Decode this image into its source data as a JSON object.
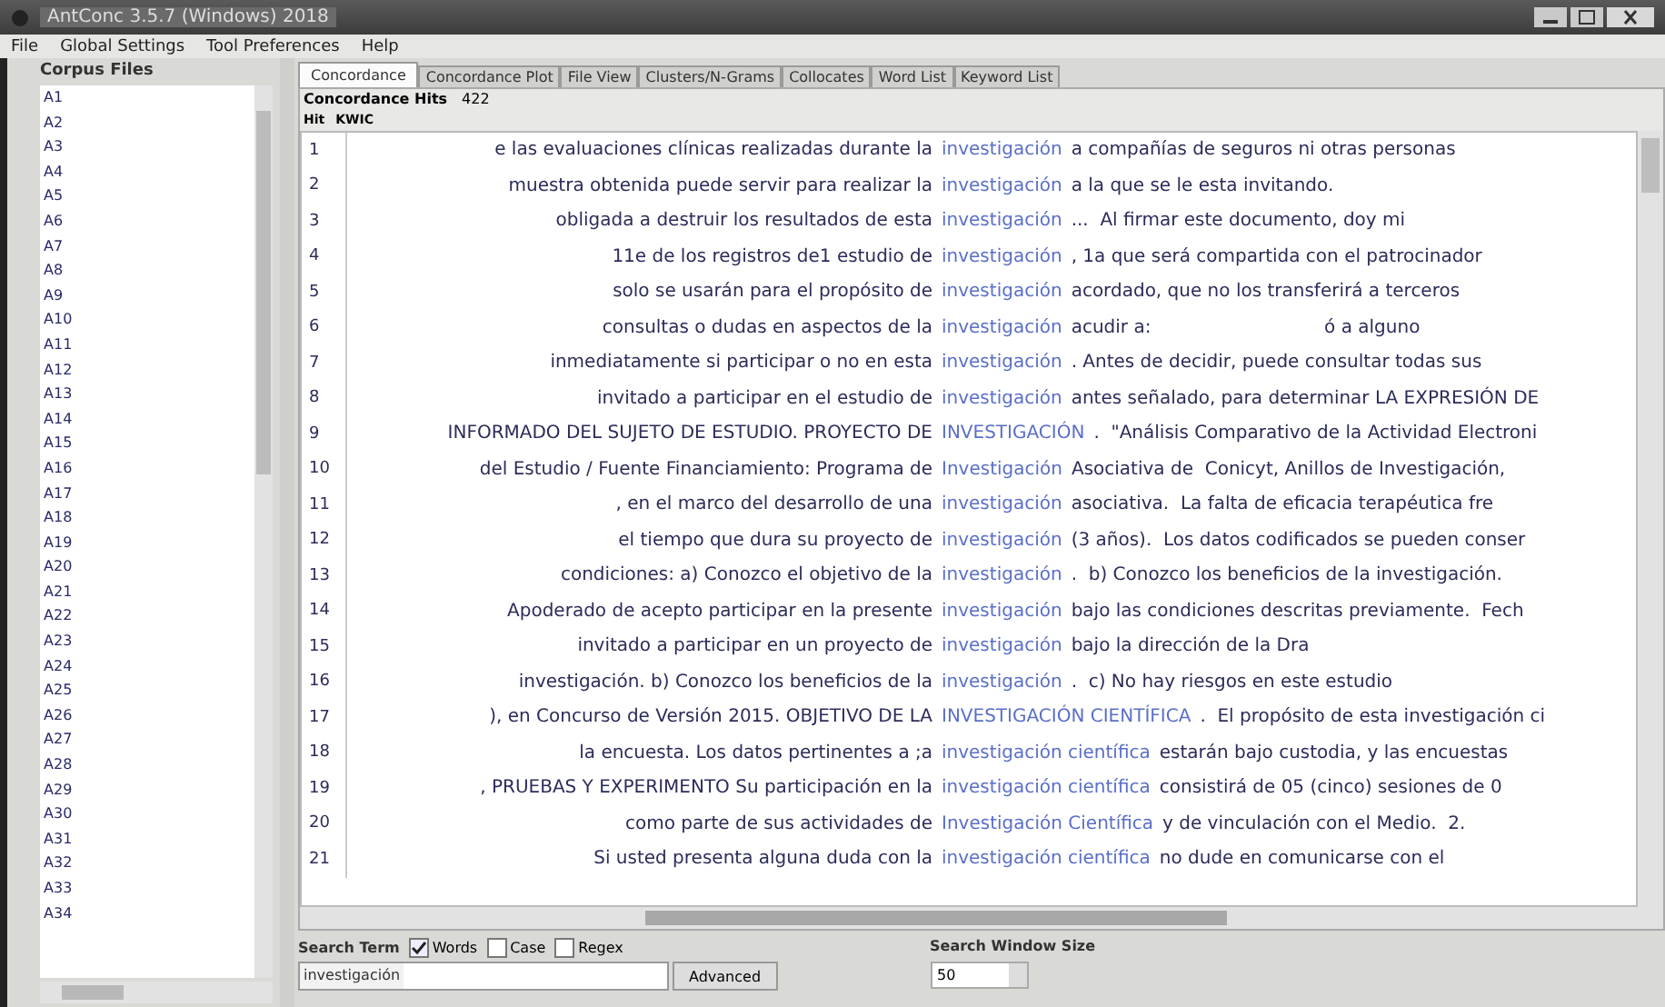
{
  "window": {
    "title": "AntConc 3.5.7 (Windows) 2018"
  },
  "menu": [
    "File",
    "Global Settings",
    "Tool Preferences",
    "Help"
  ],
  "corpus_files": {
    "title": "Corpus Files",
    "items": [
      "A1",
      "A2",
      "A3",
      "A4",
      "A5",
      "A6",
      "A7",
      "A8",
      "A9",
      "A10",
      "A11",
      "A12",
      "A13",
      "A14",
      "A15",
      "A16",
      "A17",
      "A18",
      "A19",
      "A20",
      "A21",
      "A22",
      "A23",
      "A24",
      "A25",
      "A26",
      "A27",
      "A28",
      "A29",
      "A30",
      "A31",
      "A32",
      "A33",
      "A34"
    ]
  },
  "tabs": [
    {
      "label": "Concordance",
      "selected": true
    },
    {
      "label": "Concordance Plot",
      "selected": false
    },
    {
      "label": "File View",
      "selected": false
    },
    {
      "label": "Clusters/N-Grams",
      "selected": false
    },
    {
      "label": "Collocates",
      "selected": false
    },
    {
      "label": "Word List",
      "selected": false
    },
    {
      "label": "Keyword List",
      "selected": false
    }
  ],
  "hits": {
    "label": "Concordance Hits",
    "value": "422"
  },
  "columns": [
    "Hit",
    "KWIC"
  ],
  "rows": [
    {
      "hit": "1",
      "left": "e las evaluaciones clínicas realizadas durante la",
      "keyword": "investigación",
      "right": "a compañías de seguros ni otras personas"
    },
    {
      "hit": "2",
      "left": "muestra obtenida puede servir para realizar la",
      "keyword": "investigación",
      "right": "a la que se le esta invitando."
    },
    {
      "hit": "3",
      "left": "obligada a destruir los resultados de esta",
      "keyword": "investigación",
      "right": "...  Al firmar este documento, doy mi"
    },
    {
      "hit": "4",
      "left": "11e de los registros de1 estudio de",
      "keyword": "investigación",
      "right": ", 1a que será compartida con el patrocinador"
    },
    {
      "hit": "5",
      "left": "solo se usarán para el propósito de",
      "keyword": "investigación",
      "right": "acordado, que no los transferirá a terceros"
    },
    {
      "hit": "6",
      "left": "consultas o dudas en aspectos de la",
      "keyword": "investigación",
      "right": "acudir a:                              ó a alguno"
    },
    {
      "hit": "7",
      "left": "inmediatamente si participar o no en esta",
      "keyword": "investigación",
      "right": ". Antes de decidir, puede consultar todas sus"
    },
    {
      "hit": "8",
      "left": "invitado a participar en el estudio de",
      "keyword": "investigación",
      "right": "antes señalado, para determinar LA EXPRESIÓN DE"
    },
    {
      "hit": "9",
      "left": "INFORMADO DEL SUJETO DE ESTUDIO. PROYECTO DE",
      "keyword": "INVESTIGACIÓN",
      "right": ".  \"Análisis Comparativo de la Actividad Electroni"
    },
    {
      "hit": "10",
      "left": "del Estudio / Fuente Financiamiento: Programa de",
      "keyword": "Investigación",
      "right": "Asociativa de  Conicyt, Anillos de Investigación,"
    },
    {
      "hit": "11",
      "left": ", en el marco del desarrollo de una",
      "keyword": "investigación",
      "right": "asociativa.  La falta de eficacia terapéutica fre"
    },
    {
      "hit": "12",
      "left": "el tiempo que dura su proyecto de",
      "keyword": "investigación",
      "right": "(3 años).  Los datos codificados se pueden conser"
    },
    {
      "hit": "13",
      "left": "condiciones:     a) Conozco el objetivo de la",
      "keyword": "investigación",
      "right": ".  b) Conozco los beneficios de la investigación."
    },
    {
      "hit": "14",
      "left": "Apoderado de acepto participar en la presente",
      "keyword": "investigación",
      "right": "bajo las condiciones descritas previamente.  Fech"
    },
    {
      "hit": "15",
      "left": "invitado a participar en un proyecto de",
      "keyword": "investigación",
      "right": "bajo la dirección de la Dra"
    },
    {
      "hit": "16",
      "left": "investigación.  b) Conozco los beneficios de la",
      "keyword": "investigación",
      "right": ".  c) No hay riesgos en este estudio"
    },
    {
      "hit": "17",
      "left": "), en Concurso de Versión 2015.  OBJETIVO DE LA",
      "keyword": "INVESTIGACIÓN CIENTÍFICA",
      "right": ".  El propósito de esta investigación ci"
    },
    {
      "hit": "18",
      "left": "la encuesta. Los datos pertinentes a ;a",
      "keyword": "investigación científica",
      "right": "estarán bajo custodia, y las encuestas"
    },
    {
      "hit": "19",
      "left": ", PRUEBAS Y EXPERIMENTO  Su participación en la",
      "keyword": "investigación científica",
      "right": "consistirá de 05 (cinco) sesiones de 0"
    },
    {
      "hit": "20",
      "left": "como parte de sus actividades de",
      "keyword": "Investigación Científica",
      "right": "y de vinculación con el Medio.  2."
    },
    {
      "hit": "21",
      "left": "Si usted presenta alguna duda con la",
      "keyword": "investigación científica",
      "right": "no dude en comunicarse con el"
    }
  ],
  "search": {
    "label": "Search Term",
    "options": [
      {
        "label": "Words",
        "checked": true
      },
      {
        "label": "Case",
        "checked": false
      },
      {
        "label": "Regex",
        "checked": false
      }
    ],
    "value": "investigación",
    "advanced": "Advanced"
  },
  "window_size": {
    "label": "Search Window Size",
    "value": "50"
  }
}
